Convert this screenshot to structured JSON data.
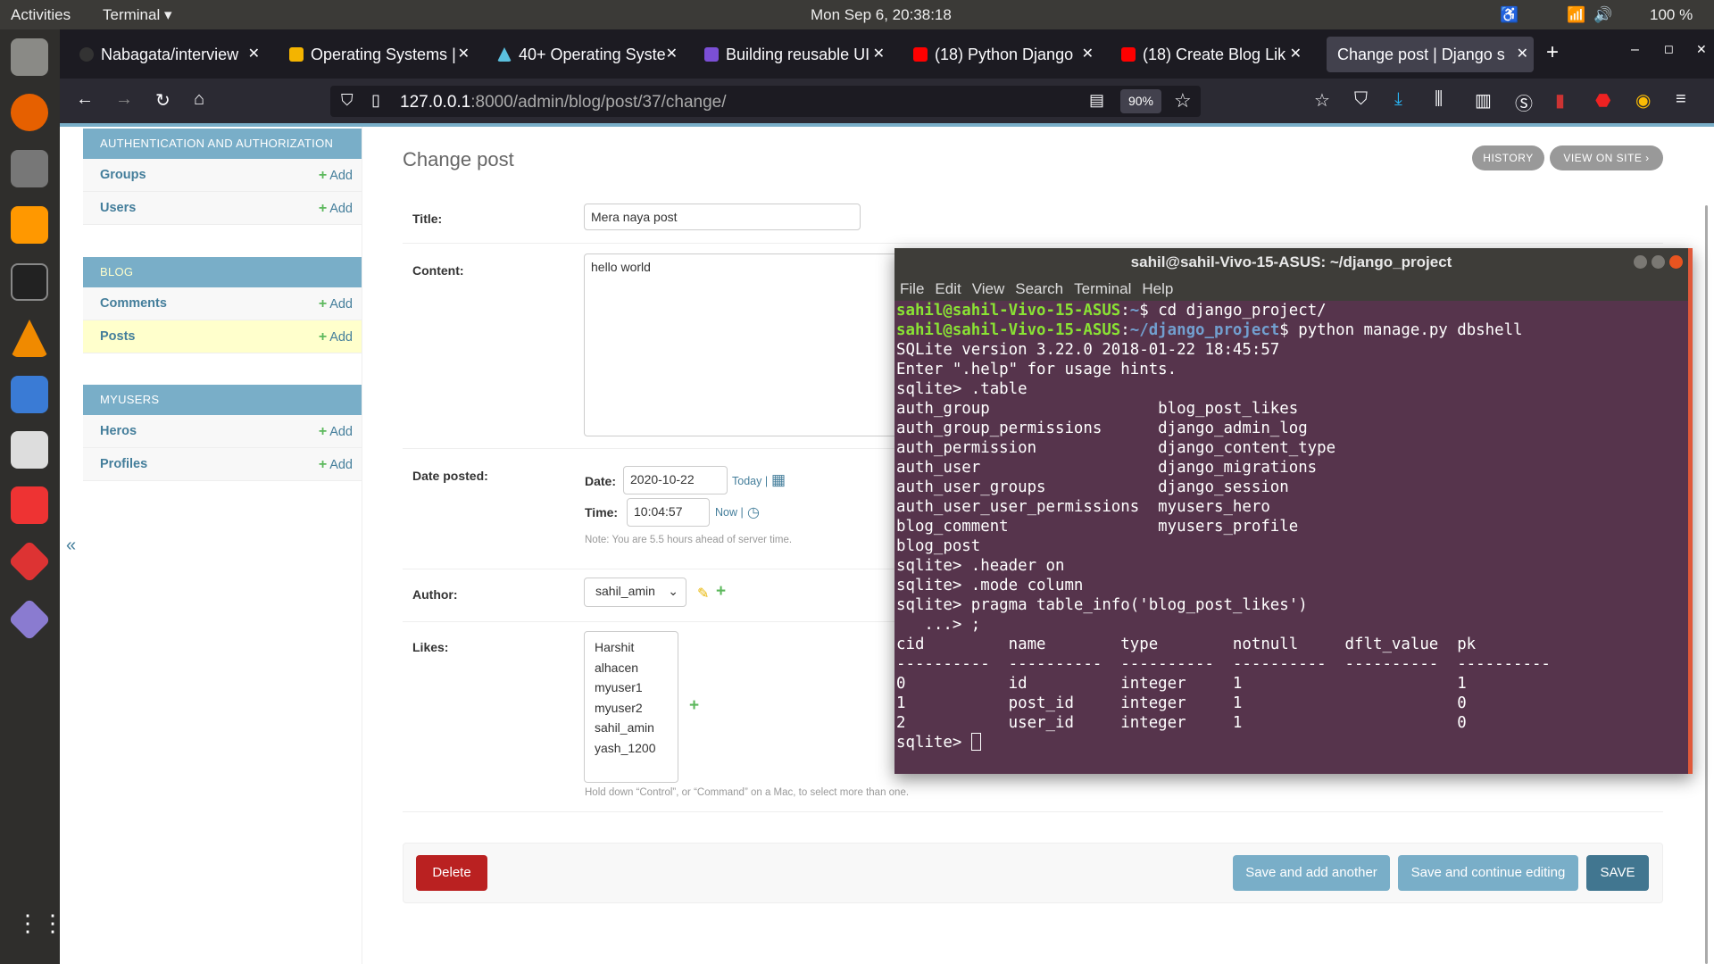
{
  "topbar": {
    "activities": "Activities",
    "app": "Terminal ▾",
    "clock": "Mon Sep  6, 20:38:18",
    "battery": "100 %"
  },
  "browser": {
    "tabs": [
      {
        "label": "Nabagata/interview",
        "color": "#333333"
      },
      {
        "label": "Operating Systems |",
        "color": "#f4b400"
      },
      {
        "label": "40+ Operating Syste",
        "color": "#5bc0de"
      },
      {
        "label": "Building reusable UI",
        "color": "#7b4fd6"
      },
      {
        "label": "(18) Python Django",
        "color": "#ff0000"
      },
      {
        "label": "(18) Create Blog Lik",
        "color": "#ff0000"
      },
      {
        "label": "Change post | Django s",
        "color": ""
      }
    ],
    "new_tab": "+",
    "url_host": "127.0.0.1",
    "url_path": ":8000/admin/blog/post/37/change/",
    "zoom": "90%"
  },
  "sidebar": {
    "modules": [
      {
        "title": "AUTHENTICATION AND AUTHORIZATION",
        "items": [
          {
            "label": "Groups",
            "add": "Add"
          },
          {
            "label": "Users",
            "add": "Add"
          }
        ]
      },
      {
        "title": "BLOG",
        "items": [
          {
            "label": "Comments",
            "add": "Add"
          },
          {
            "label": "Posts",
            "add": "Add"
          }
        ]
      },
      {
        "title": "MYUSERS",
        "items": [
          {
            "label": "Heros",
            "add": "Add"
          },
          {
            "label": "Profiles",
            "add": "Add"
          }
        ]
      }
    ],
    "collapse": "«"
  },
  "form": {
    "heading": "Change post",
    "history": "HISTORY",
    "view_on_site": "VIEW ON SITE ›",
    "title_label": "Title:",
    "title_value": "Mera naya post",
    "content_label": "Content:",
    "content_value": "hello world",
    "date_posted_label": "Date posted:",
    "date_label": "Date:",
    "date_value": "2020-10-22",
    "today": "Today |",
    "time_label": "Time:",
    "time_value": "10:04:57",
    "now": "Now |",
    "tz_note": "Note: You are 5.5 hours ahead of server time.",
    "author_label": "Author:",
    "author_value": "sahil_amin",
    "likes_label": "Likes:",
    "likes_options": [
      "Harshit",
      "alhacen",
      "myuser1",
      "myuser2",
      "sahil_amin",
      "yash_1200"
    ],
    "likes_help": "Hold down “Control”, or “Command” on a Mac, to select more than one.",
    "delete": "Delete",
    "save_add": "Save and add another",
    "save_continue": "Save and continue editing",
    "save": "SAVE"
  },
  "terminal": {
    "title": "sahil@sahil-Vivo-15-ASUS: ~/django_project",
    "menu": [
      "File",
      "Edit",
      "View",
      "Search",
      "Terminal",
      "Help"
    ],
    "prompt_user": "sahil@sahil-Vivo-15-ASUS",
    "line1_path": "~",
    "line1_cmd": "$ cd django_project/",
    "line2_path": "~/django_project",
    "line2_cmd": "$ python manage.py dbshell",
    "output": "SQLite version 3.22.0 2018-01-22 18:45:57\nEnter \".help\" for usage hints.\nsqlite> .table\nauth_group                  blog_post_likes\nauth_group_permissions      django_admin_log\nauth_permission             django_content_type\nauth_user                   django_migrations\nauth_user_groups            django_session\nauth_user_user_permissions  myusers_hero\nblog_comment                myusers_profile\nblog_post\nsqlite> .header on\nsqlite> .mode column\nsqlite> pragma table_info('blog_post_likes')\n   ...> ;\ncid         name        type        notnull     dflt_value  pk\n----------  ----------  ----------  ----------  ----------  ----------\n0           id          integer     1                       1\n1           post_id     integer     1                       0\n2           user_id     integer     1                       0\nsqlite> "
  }
}
